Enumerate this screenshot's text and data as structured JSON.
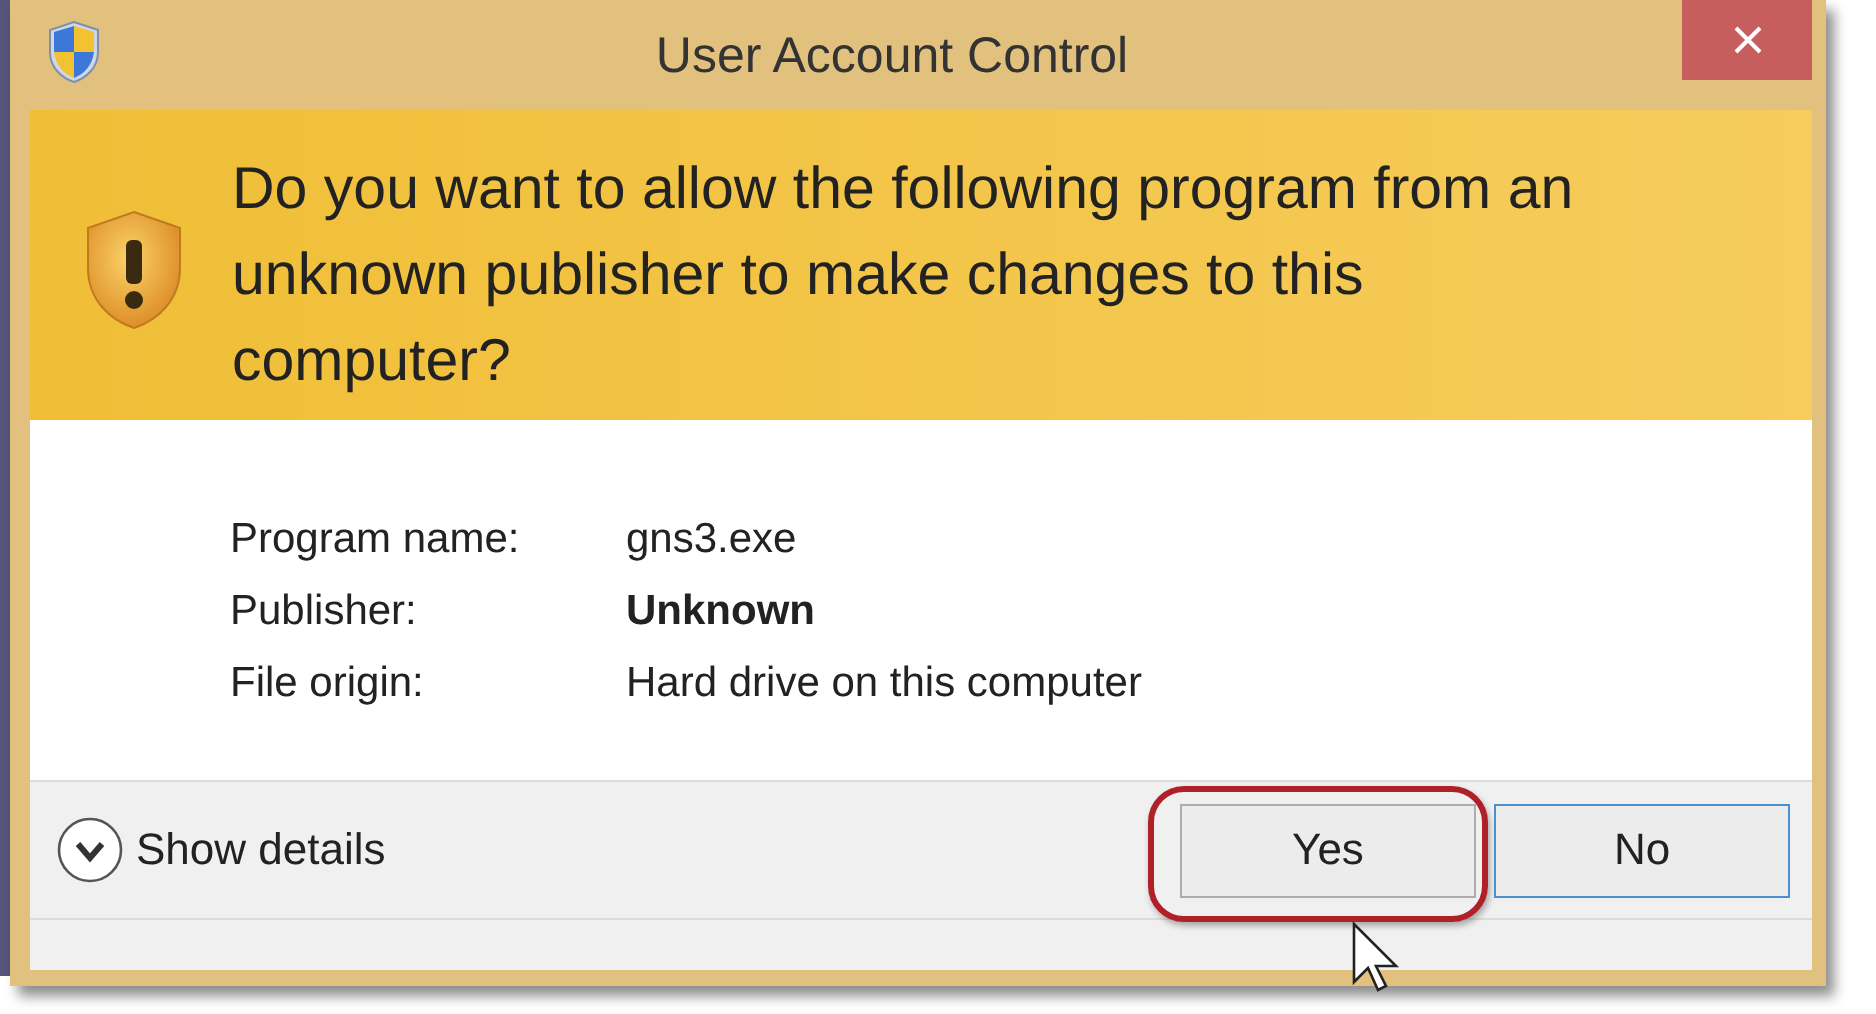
{
  "window": {
    "title": "User Account Control"
  },
  "banner": {
    "question": "Do you want to allow the following program from an unknown publisher to make changes to this computer?"
  },
  "details": [
    {
      "label": "Program name:",
      "value": "gns3.exe",
      "bold": false
    },
    {
      "label": "Publisher:",
      "value": "Unknown",
      "bold": true
    },
    {
      "label": "File origin:",
      "value": "Hard drive on this computer",
      "bold": false
    }
  ],
  "show_details": {
    "label": "Show details",
    "expanded": false
  },
  "buttons": [
    {
      "label": "Yes",
      "default": false,
      "annotated": true
    },
    {
      "label": "No",
      "default": true,
      "annotated": false
    }
  ]
}
